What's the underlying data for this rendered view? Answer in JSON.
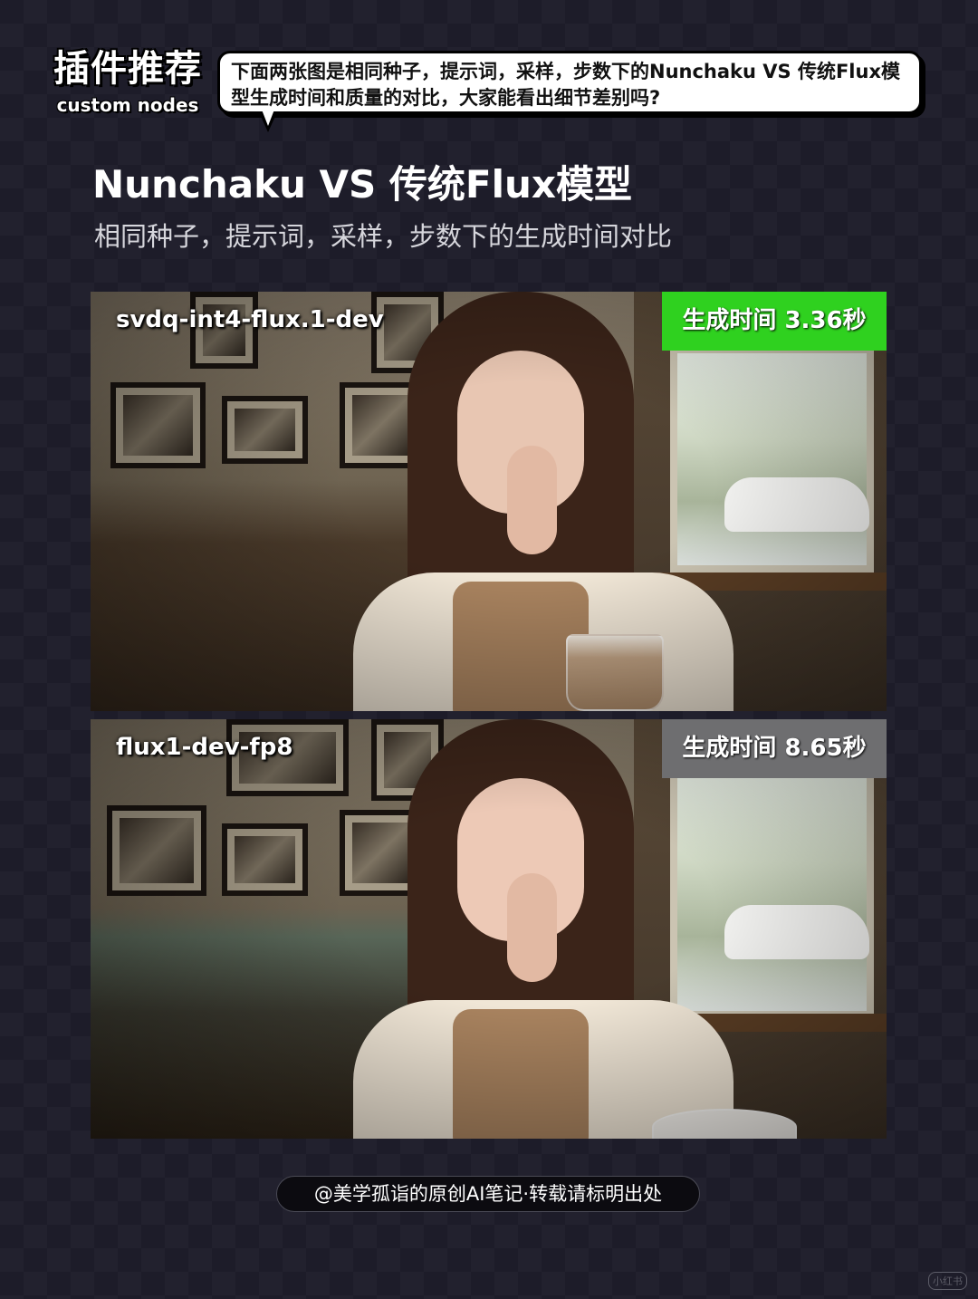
{
  "header": {
    "badge_title": "插件推荐",
    "badge_subtitle": "custom nodes",
    "bubble_text": "下面两张图是相同种子，提示词，采样，步数下的Nunchaku VS 传统Flux模型生成时间和质量的对比，大家能看出细节差别吗?"
  },
  "main": {
    "title": "Nunchaku VS 传统Flux模型",
    "subtitle": "相同种子，提示词，采样，步数下的生成时间对比"
  },
  "panels": [
    {
      "model": "svdq-int4-flux.1-dev",
      "time": "生成时间 3.36秒",
      "badge_color": "#2fd11f"
    },
    {
      "model": "flux1-dev-fp8",
      "time": "生成时间 8.65秒",
      "badge_color": "#6e6e70"
    }
  ],
  "footer": {
    "credit": "@美学孤诣的原创AI笔记·转载请标明出处"
  },
  "watermark": {
    "text": "小红书"
  }
}
